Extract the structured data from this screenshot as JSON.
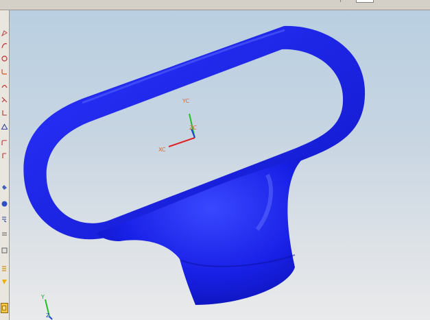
{
  "viewport": {
    "wcs": {
      "x_label": "XC",
      "y_label": "YC",
      "z_label": "ZC"
    },
    "view_triad": {
      "y_label": "Y",
      "z_label": "Z"
    }
  },
  "toolbar": {
    "items": [
      "sketch-icon",
      "curve-icon",
      "circle-icon",
      "fillet-icon",
      "arc-icon",
      "trim-icon",
      "bend-icon",
      "polygon-icon",
      "spline-icon",
      "layer-icon",
      "sphere-icon",
      "shape-icon",
      "line-icon",
      "cylinder-icon",
      "stack-icon",
      "part-icon"
    ]
  },
  "colors": {
    "part": "#1a22e8",
    "x_axis": "#e02020",
    "y_axis": "#20c020",
    "z_axis": "#2040d0",
    "label": "#d86a2a"
  }
}
